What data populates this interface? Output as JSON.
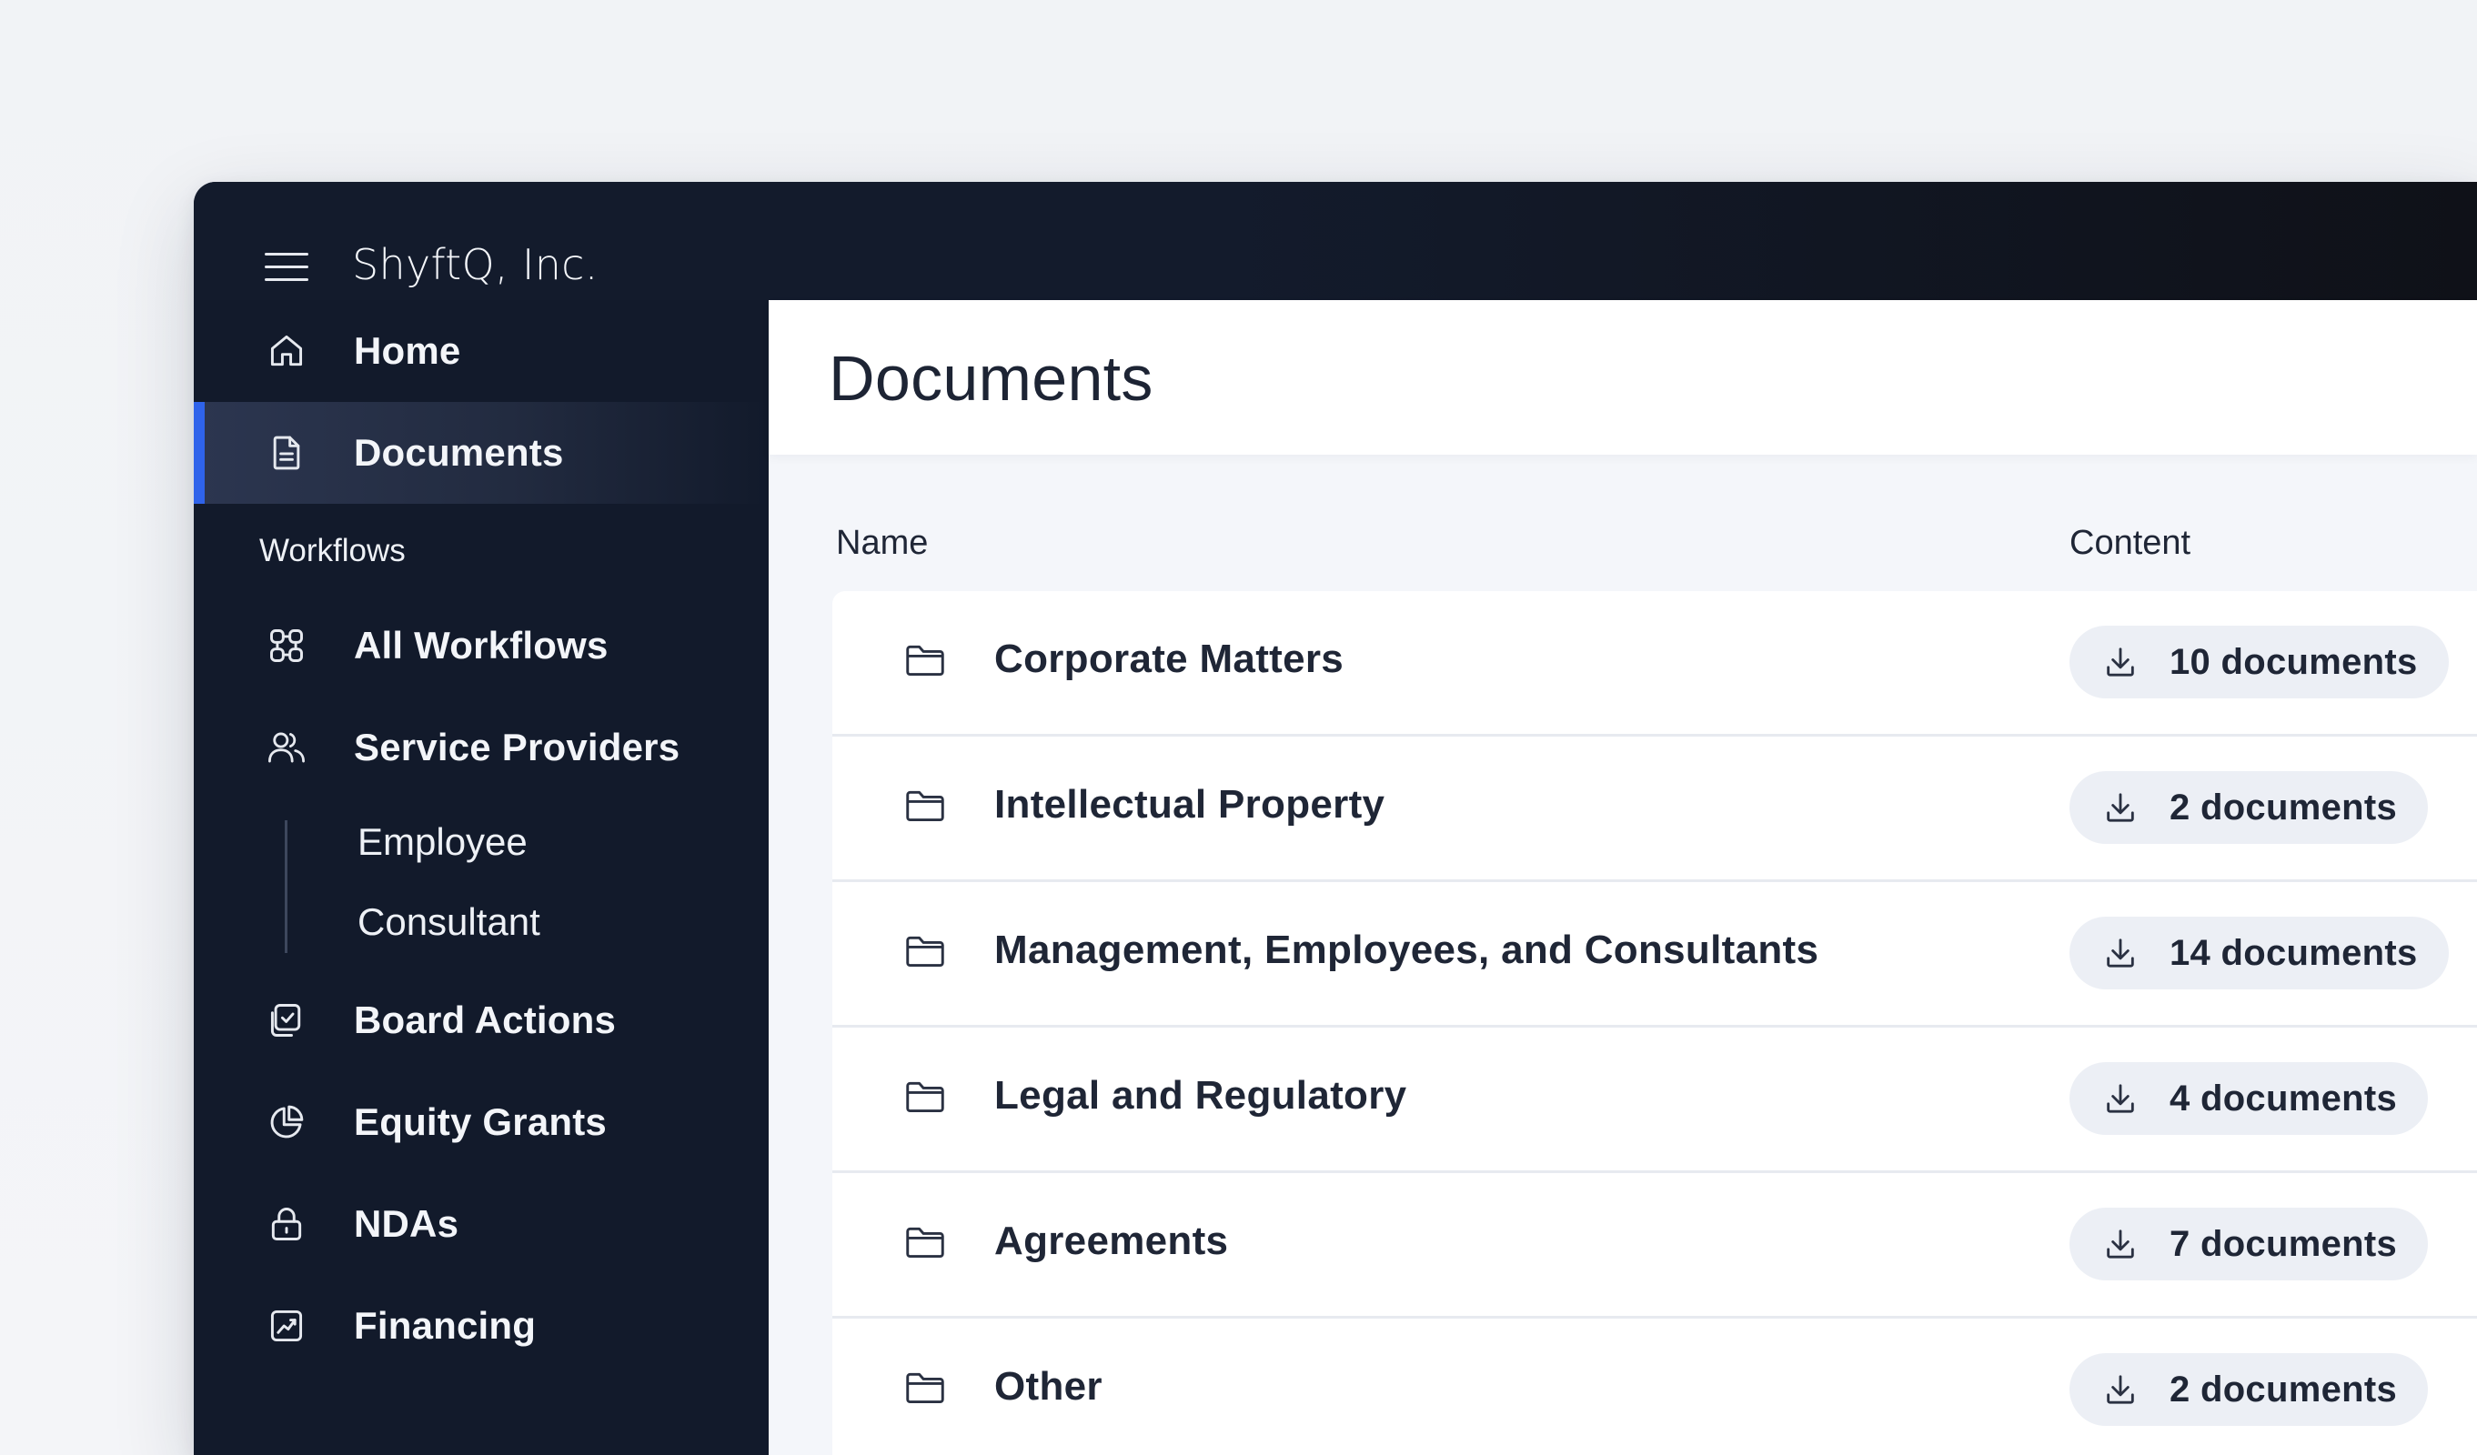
{
  "app": {
    "org_name": "ShyftQ, Inc.",
    "menu_icon": "hamburger-menu-icon"
  },
  "sidebar": {
    "top_items": [
      {
        "label": "Home",
        "icon": "home-icon"
      },
      {
        "label": "Documents",
        "icon": "document-icon",
        "active": true
      }
    ],
    "section_label": "Workflows",
    "workflow_items": [
      {
        "label": "All Workflows",
        "icon": "grid-nodes-icon"
      },
      {
        "label": "Service Providers",
        "icon": "users-icon"
      }
    ],
    "sub_items": [
      {
        "label": "Employee"
      },
      {
        "label": "Consultant"
      }
    ],
    "more_items": [
      {
        "label": "Board Actions",
        "icon": "board-check-icon"
      },
      {
        "label": "Equity Grants",
        "icon": "pie-chart-icon"
      },
      {
        "label": "NDAs",
        "icon": "lock-icon"
      },
      {
        "label": "Financing",
        "icon": "chart-line-icon"
      }
    ]
  },
  "main": {
    "title": "Documents",
    "columns": {
      "name": "Name",
      "content": "Content"
    },
    "rows": [
      {
        "name": "Corporate Matters",
        "count": "10 documents"
      },
      {
        "name": "Intellectual Property",
        "count": "2 documents"
      },
      {
        "name": "Management, Employees, and Consultants",
        "count": "14 documents"
      },
      {
        "name": "Legal and Regulatory",
        "count": "4 documents"
      },
      {
        "name": "Agreements",
        "count": "7 documents"
      },
      {
        "name": "Other",
        "count": "2 documents"
      }
    ]
  },
  "colors": {
    "sidebar_bg": "#121a2b",
    "accent": "#2f63ea",
    "page_bg": "#f4f6fa",
    "pill_bg": "#eceff5"
  }
}
